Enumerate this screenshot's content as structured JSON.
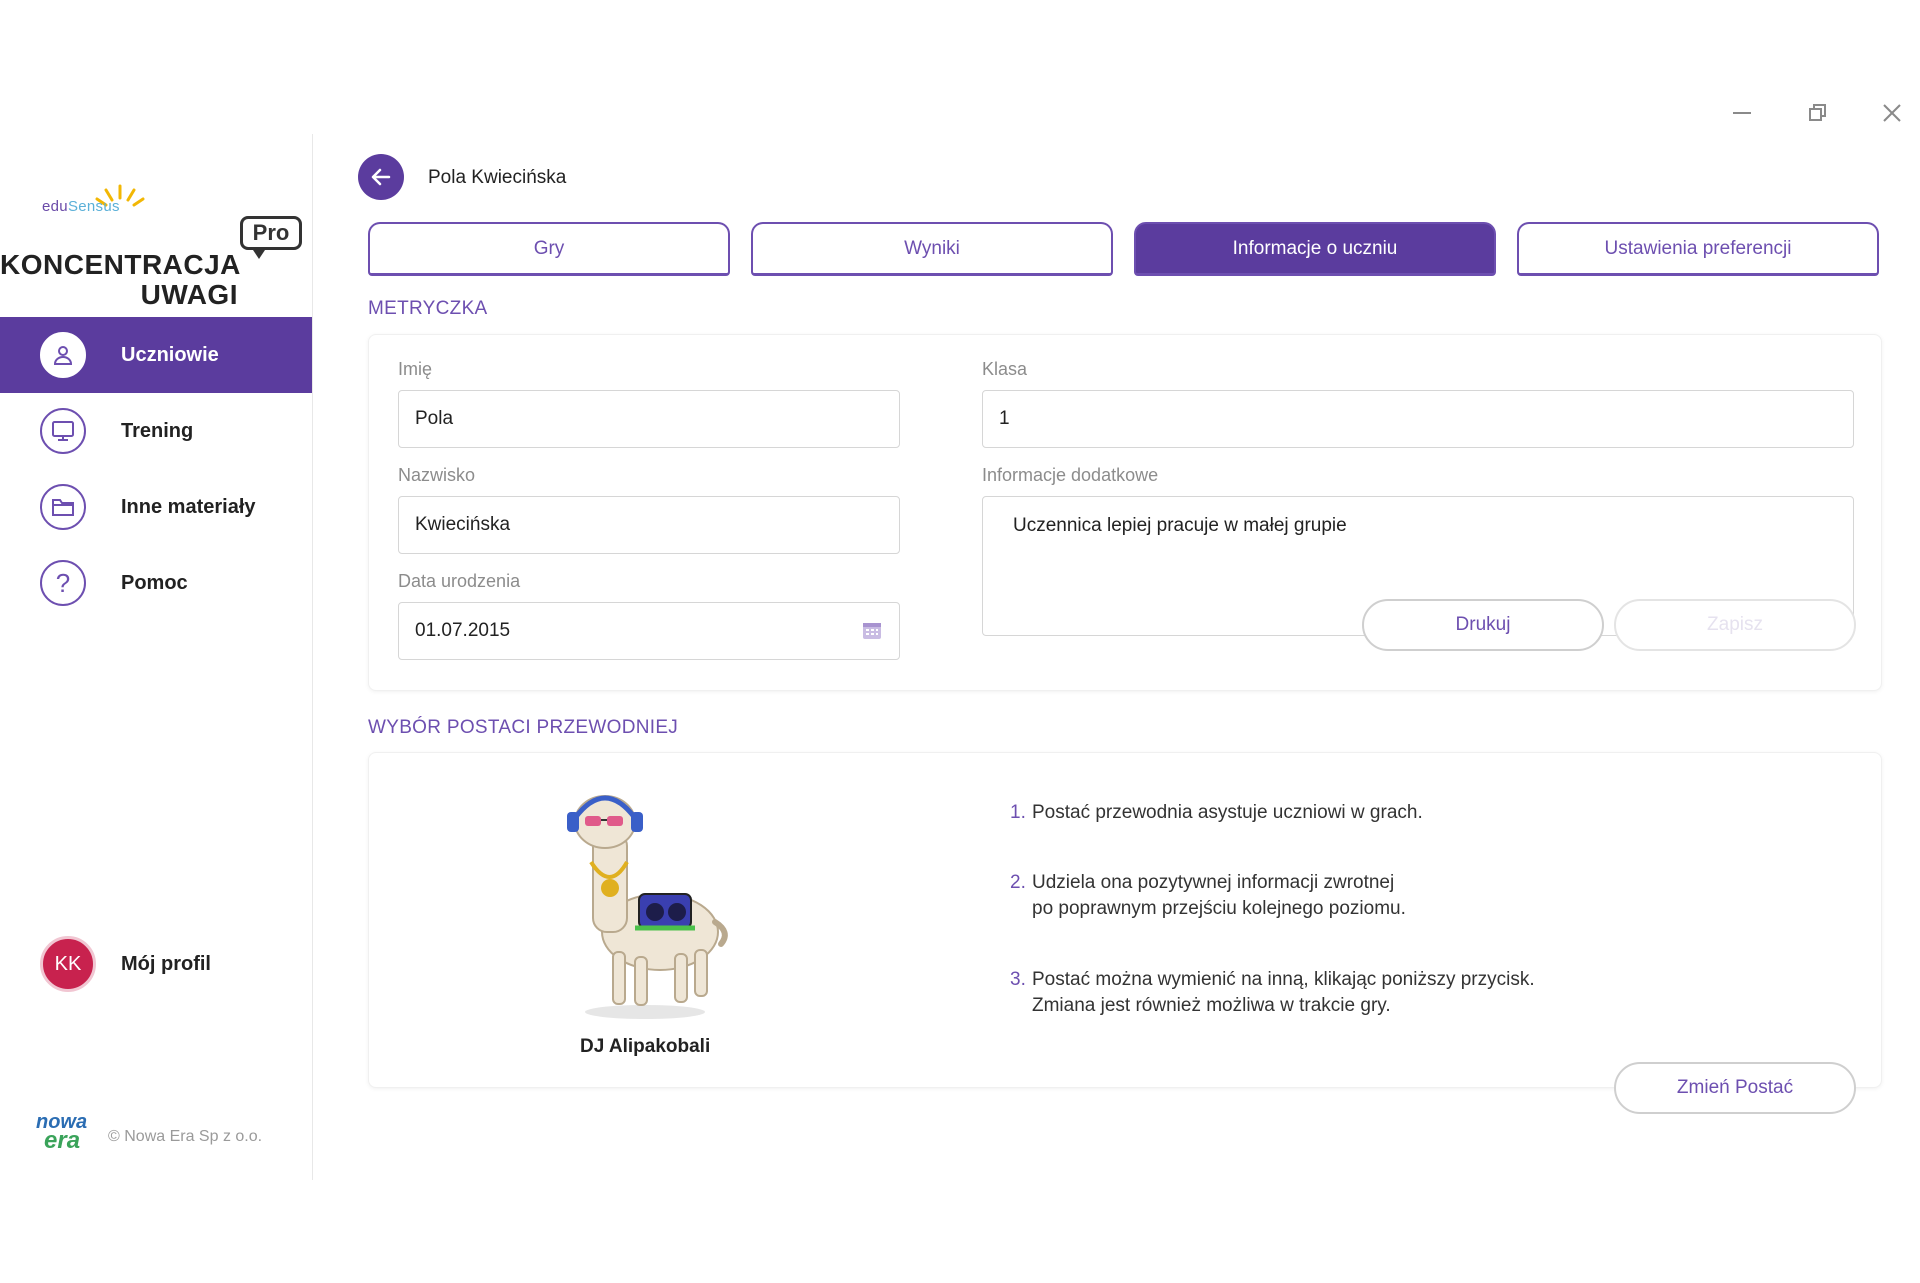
{
  "window": {
    "minimize_icon": "minimize-icon",
    "maximize_icon": "restore-icon",
    "close_icon": "close-icon"
  },
  "sidebar": {
    "brand": {
      "logo_text_a": "edu",
      "logo_text_b": "Sensus",
      "app_title_line1": "KONCENTRACJA",
      "app_title_line2": "UWAGI",
      "badge": "Pro"
    },
    "items": [
      {
        "label": "Uczniowie",
        "icon": "user-icon",
        "active": true
      },
      {
        "label": "Trening",
        "icon": "monitor-icon",
        "active": false
      },
      {
        "label": "Inne materiały",
        "icon": "folder-icon",
        "active": false
      },
      {
        "label": "Pomoc",
        "icon": "help-icon",
        "active": false
      }
    ],
    "profile": {
      "initials": "KK",
      "label": "Mój profil",
      "avatar_color": "#c8224e"
    },
    "footer": {
      "publisher_a": "nowa",
      "publisher_b": "era",
      "copyright": "© Nowa Era Sp z o.o."
    }
  },
  "header": {
    "back_icon": "arrow-left-icon",
    "student_name": "Pola Kwiecińska"
  },
  "tabs": [
    {
      "label": "Gry",
      "active": false
    },
    {
      "label": "Wyniki",
      "active": false
    },
    {
      "label": "Informacje o uczniu",
      "active": true
    },
    {
      "label": "Ustawienia preferencji",
      "active": false
    }
  ],
  "metryczka": {
    "title": "METRYCZKA",
    "first_name": {
      "label": "Imię",
      "value": "Pola"
    },
    "last_name": {
      "label": "Nazwisko",
      "value": "Kwiecińska"
    },
    "birth_date": {
      "label": "Data urodzenia",
      "value": "01.07.2015",
      "icon": "calendar-icon"
    },
    "class": {
      "label": "Klasa",
      "value": "1"
    },
    "additional": {
      "label": "Informacje dodatkowe",
      "value": "Uczennica lepiej pracuje w małej grupie"
    },
    "print_label": "Drukuj",
    "save_label": "Zapisz"
  },
  "guide": {
    "title": "WYBÓR POSTACI PRZEWODNIEJ",
    "character_name": "DJ Alipakobali",
    "info": [
      {
        "num": "1.",
        "text": "Postać przewodnia asystuje uczniowi w grach."
      },
      {
        "num": "2.",
        "text": "Udziela ona pozytywnej informacji zwrotnej\npo poprawnym przejściu kolejnego poziomu."
      },
      {
        "num": "3.",
        "text": "Postać można wymienić na inną, klikając poniższy przycisk.\nZmiana jest również możliwa w trakcie gry."
      }
    ],
    "change_label": "Zmień Postać"
  },
  "colors": {
    "accent": "#5b3c9e",
    "accent_light": "#6d4fb0",
    "avatar": "#c8224e"
  }
}
